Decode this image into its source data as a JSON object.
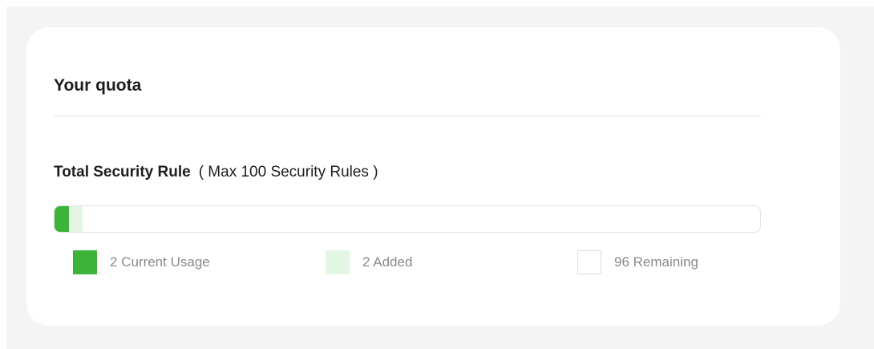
{
  "quota": {
    "title": "Your quota",
    "rule_label": "Total Security Rule",
    "max_label": "( Max 100 Security Rules )",
    "max": 100,
    "current_usage": 2,
    "added": 2,
    "remaining": 96,
    "legend": {
      "usage": "2 Current Usage",
      "added": "2 Added",
      "remaining": "96 Remaining"
    },
    "colors": {
      "usage": "#3db33a",
      "added": "#e3f6e3",
      "remaining": "#ffffff"
    }
  }
}
